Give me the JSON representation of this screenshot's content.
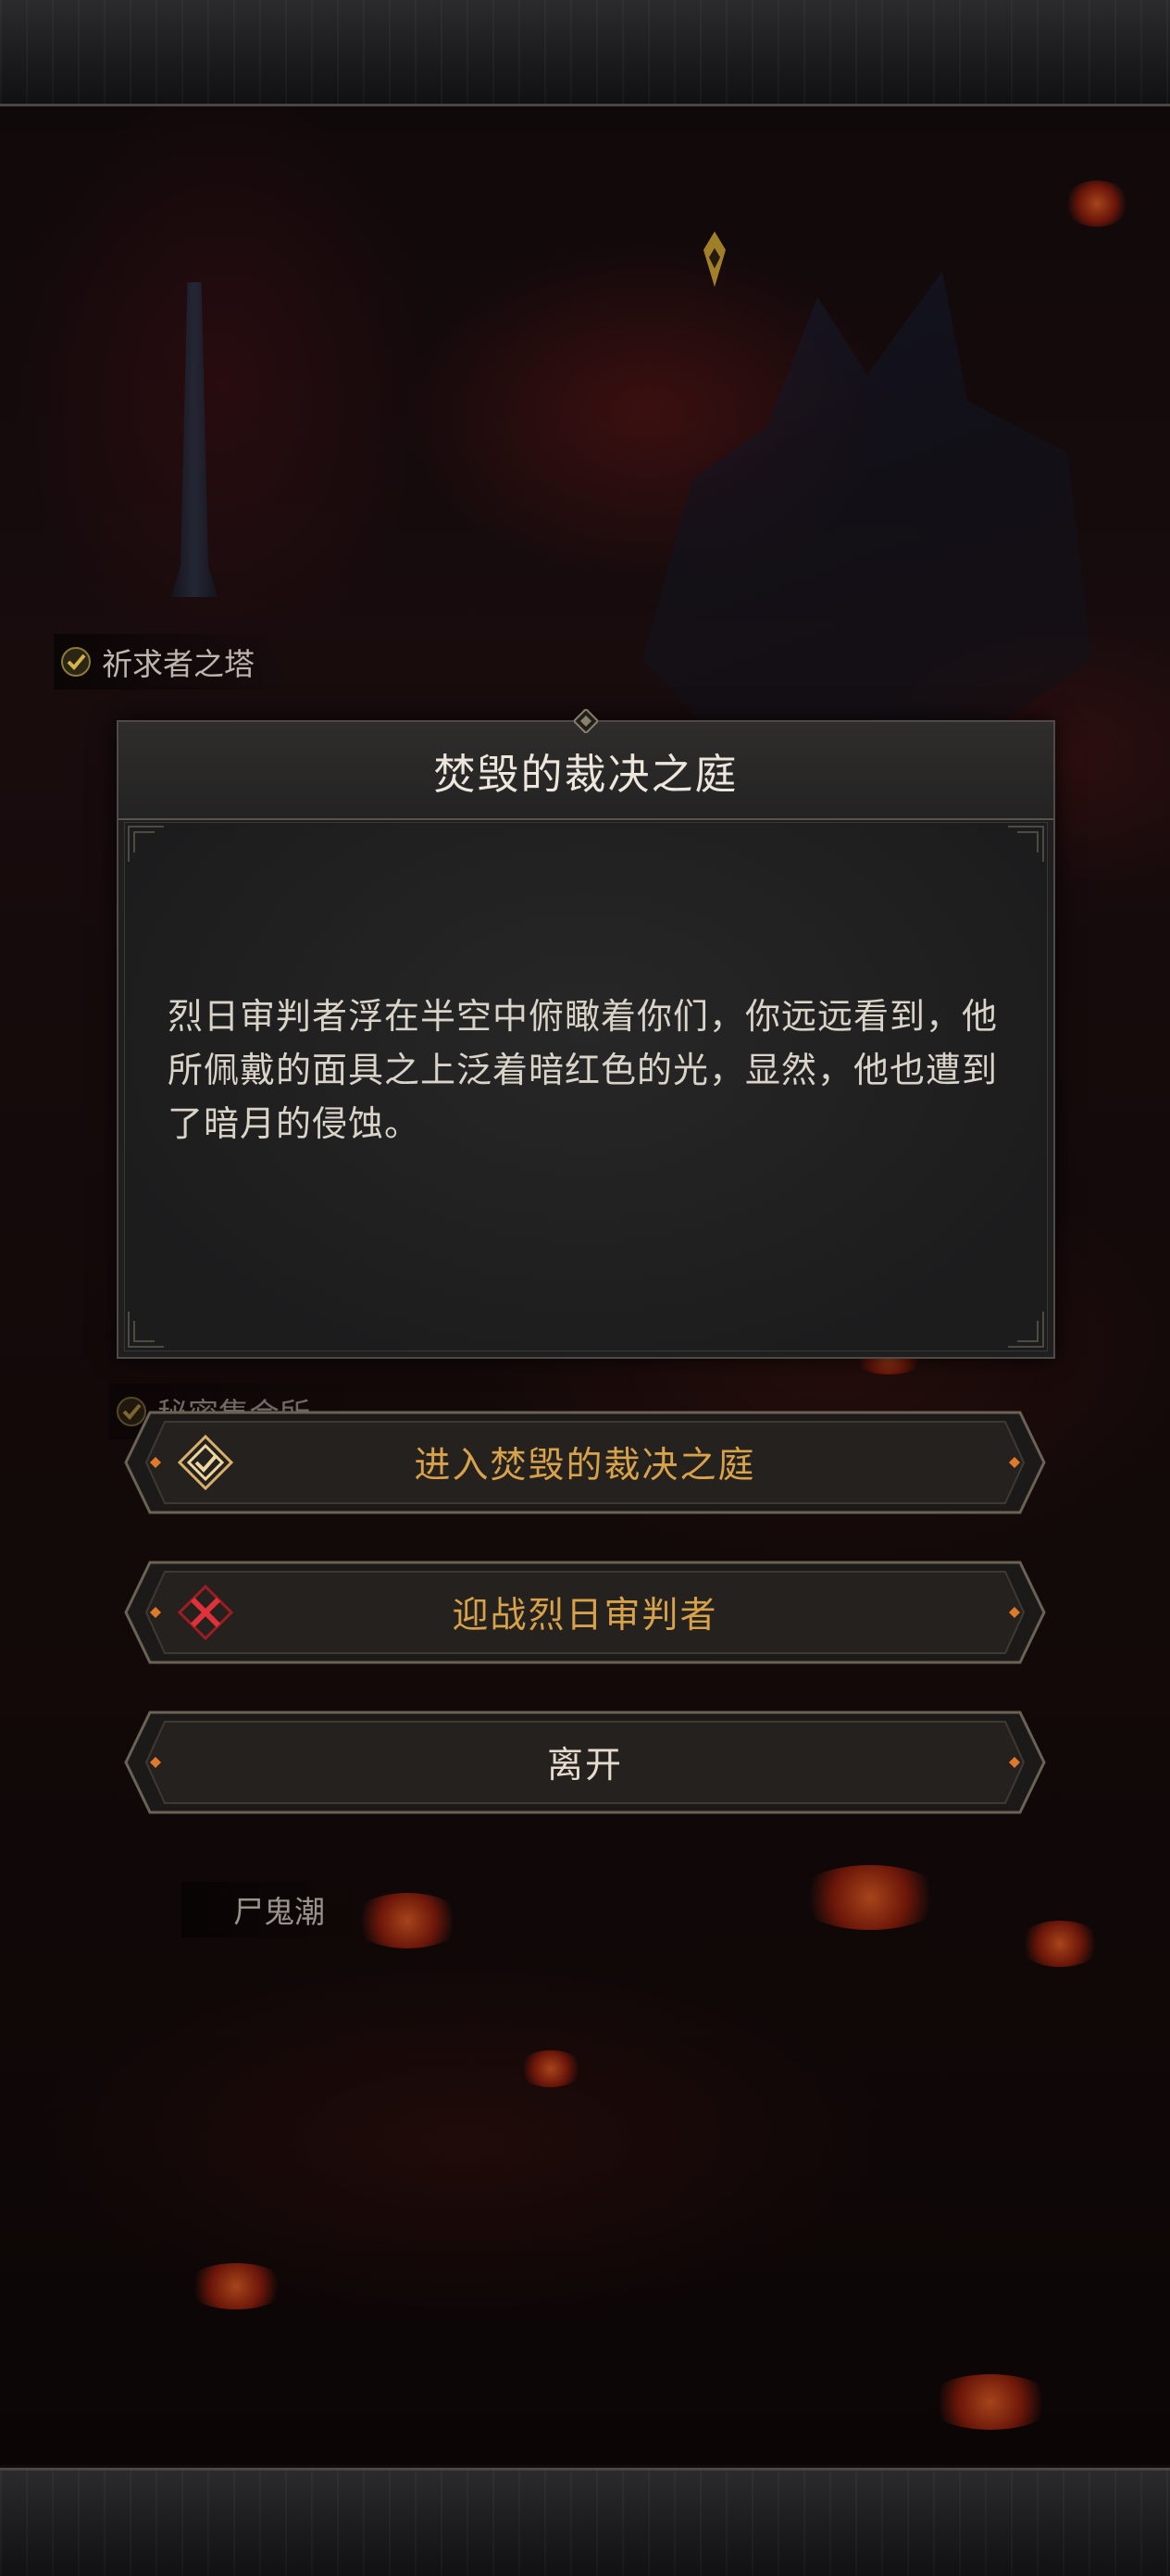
{
  "map": {
    "labels": {
      "tower_of_supplicants": "祈求者之塔",
      "secret_gathering": "秘密集会所",
      "corpse_tide": "尸鬼潮",
      "faded_caption": "焚毁的裁决之庭"
    }
  },
  "dialog": {
    "title": "焚毁的裁决之庭",
    "description": "烈日审判者浮在半空中俯瞰着你们，你远远看到，他所佩戴的面具之上泛着暗红色的光，显然，他也遭到了暗月的侵蚀。"
  },
  "options": [
    {
      "label": "进入焚毁的裁决之庭",
      "icon": "enter-diamond-icon"
    },
    {
      "label": "迎战烈日审判者",
      "icon": "crossed-swords-icon"
    },
    {
      "label": "离开",
      "icon": ""
    }
  ],
  "colors": {
    "accent_gold": "#d8a24a",
    "ember": "#ff6a2a",
    "combat_red": "#c4202a"
  }
}
